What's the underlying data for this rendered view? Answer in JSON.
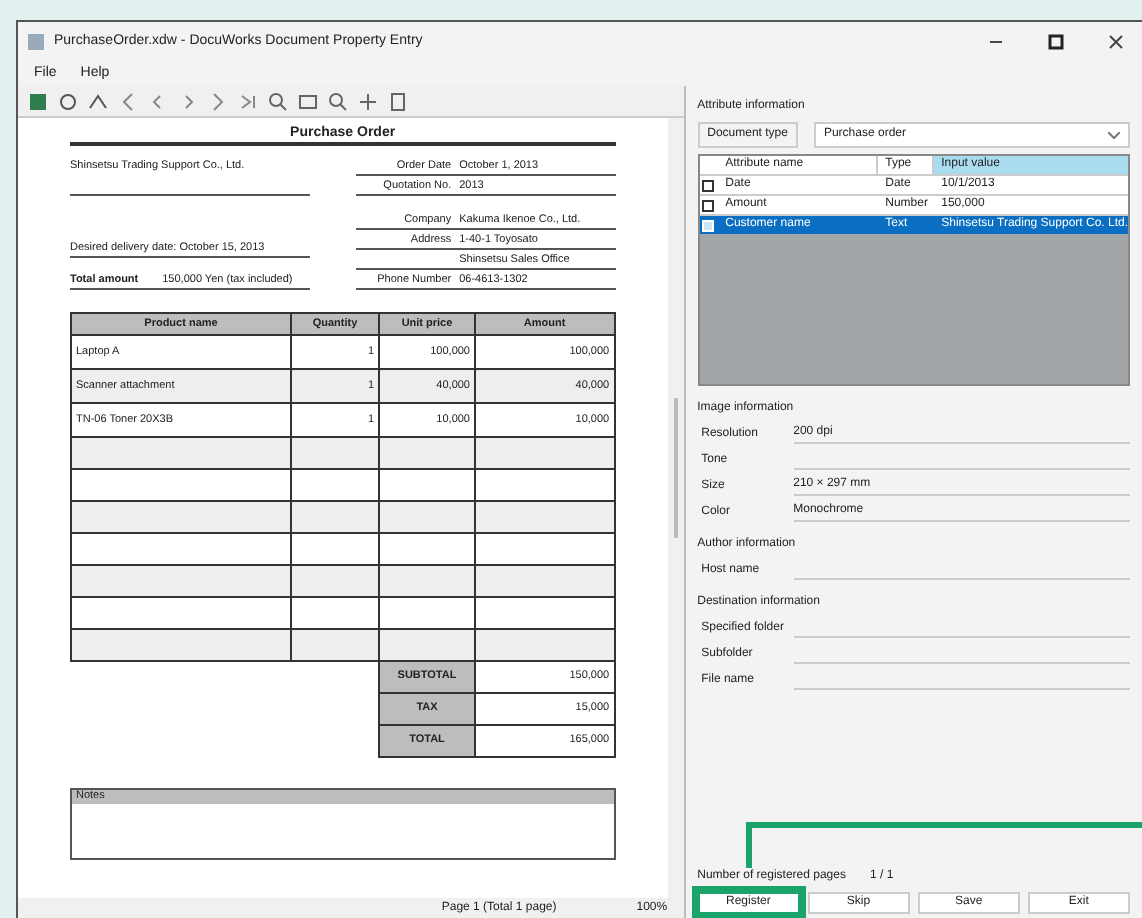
{
  "window": {
    "title": "PurchaseOrder.xdw - DocuWorks Document Property Entry"
  },
  "menu": [
    "File",
    "Help"
  ],
  "document": {
    "title": "Purchase Order",
    "recipient": "Shinsetsu Trading Support Co., Ltd.",
    "header_fields": [
      {
        "label": "Order Date",
        "value": "October 1, 2013"
      },
      {
        "label": "Quotation No.",
        "value": "2013"
      }
    ],
    "vendor_fields": [
      {
        "label": "Company",
        "value": "Kakuma Ikenoe Co., Ltd."
      },
      {
        "label": "Address",
        "value": "1-40-1 Toyosato"
      },
      {
        "label": "Phone Number",
        "value": "06-4613-1302"
      }
    ],
    "delivery": "Desired delivery date: October 15, 2013",
    "vendor_note": "Shinsetsu Sales Office",
    "total_label": "Total amount",
    "total_value": "150,000 Yen (tax included)",
    "columns": [
      "Product name",
      "Quantity",
      "Unit price",
      "Amount"
    ],
    "rows": [
      [
        "Laptop A",
        "1",
        "100,000",
        "100,000"
      ],
      [
        "Scanner attachment",
        "1",
        "40,000",
        "40,000"
      ],
      [
        "TN-06 Toner 20X3B",
        "1",
        "10,000",
        "10,000"
      ]
    ],
    "totals": [
      {
        "label": "SUBTOTAL",
        "value": "150,000"
      },
      {
        "label": "TAX",
        "value": "15,000"
      },
      {
        "label": "TOTAL",
        "value": "165,000"
      }
    ],
    "notes_label": "Notes"
  },
  "status_bar": {
    "page": "Page 1 (Total 1 page)",
    "zoom": "100%"
  },
  "attributes": {
    "title": "Attribute information",
    "doc_type_label": "Document type",
    "doc_type": "Purchase order",
    "columns": [
      "Attribute name",
      "Type",
      "Input value"
    ],
    "rows": [
      {
        "name": "Date",
        "type": "Date",
        "value": "10/1/2013",
        "checked": false,
        "selected": false
      },
      {
        "name": "Amount",
        "type": "Number",
        "value": "150,000",
        "checked": false,
        "selected": false
      },
      {
        "name": "Customer name",
        "type": "Text",
        "value": "Shinsetsu Trading Support Co. Ltd.",
        "checked": true,
        "selected": true
      }
    ]
  },
  "image_info": {
    "title": "Image information",
    "fields": [
      {
        "label": "Resolution",
        "value": "200 dpi"
      },
      {
        "label": "Tone"
      },
      {
        "label": "Size",
        "value": "210 × 297 mm"
      },
      {
        "label": "Color",
        "value": "Monochrome"
      }
    ]
  },
  "author_info": {
    "title": "Author information",
    "fields": [
      {
        "label": "Host name"
      }
    ]
  },
  "destination_info": {
    "title": "Destination information",
    "fields": [
      {
        "label": "Specified folder"
      },
      {
        "label": "Subfolder"
      },
      {
        "label": "File name"
      }
    ]
  },
  "pages": {
    "label": "Number of registered pages",
    "value": "1 / 1"
  },
  "buttons": [
    {
      "label": "Register",
      "highlighted": true
    },
    {
      "label": "Skip",
      "highlighted": false
    },
    {
      "label": "Save",
      "highlighted": false
    },
    {
      "label": "Exit",
      "highlighted": false
    }
  ]
}
